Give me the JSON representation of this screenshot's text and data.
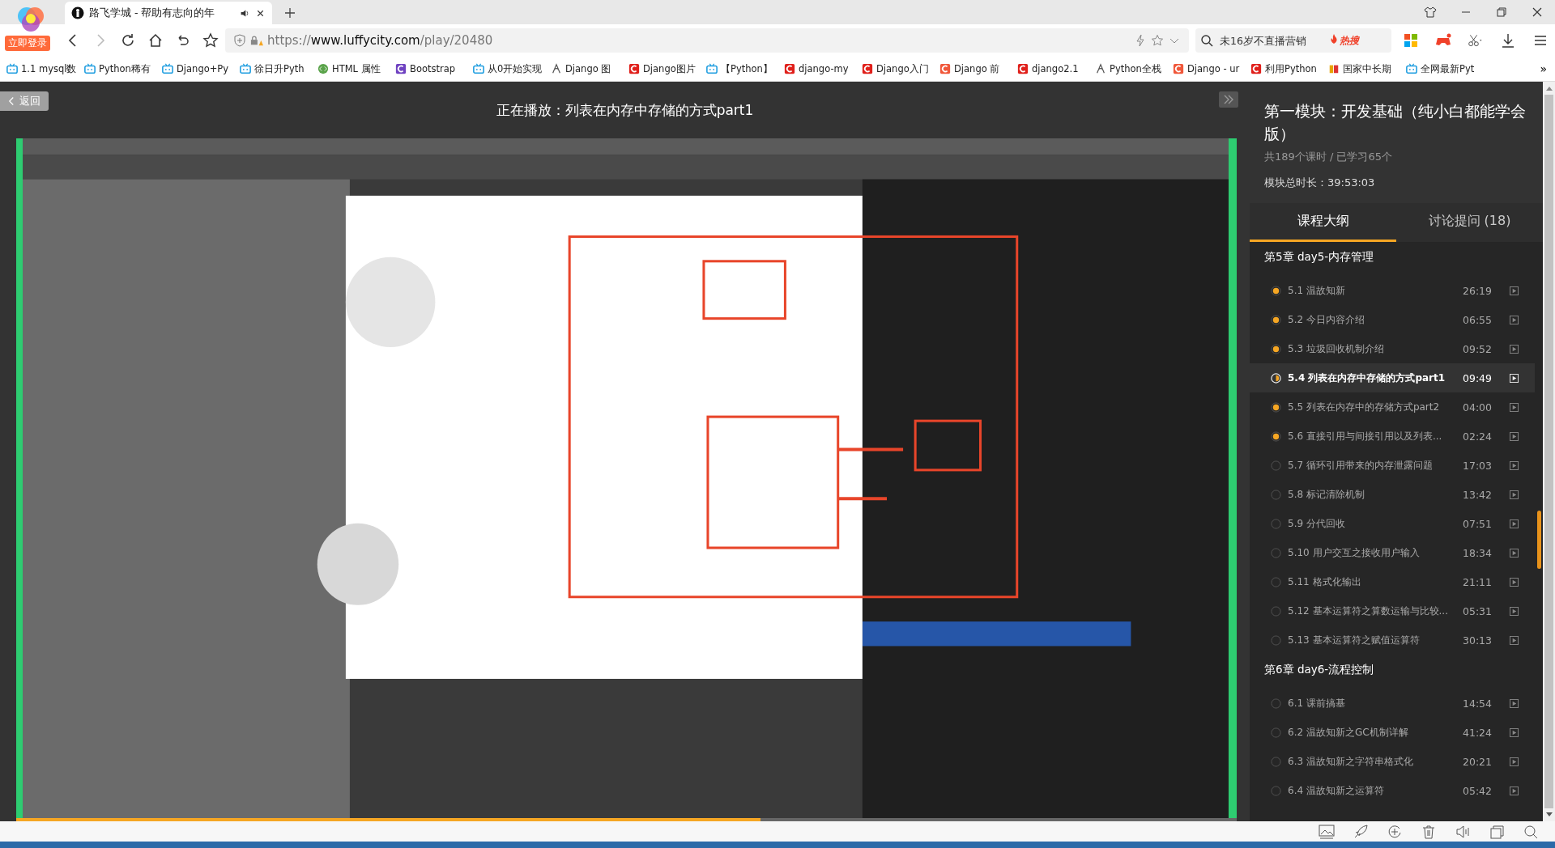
{
  "browser": {
    "login_badge": "立即登录",
    "tab": {
      "title": "路飞学城 - 帮助有志向的年",
      "audio": true
    },
    "url_prefix": "https://",
    "url_host": "www.luffycity.com",
    "url_path": "/play/20480",
    "search_placeholder": "未16岁不直播营销",
    "hot_badge": "热搜"
  },
  "bookmarks": [
    {
      "kind": "tv",
      "label": "1.1 mysql数"
    },
    {
      "kind": "tv",
      "label": "Python稀有"
    },
    {
      "kind": "tv",
      "label": "Django+Py"
    },
    {
      "kind": "tv",
      "label": "徐日升Pyth"
    },
    {
      "kind": "html",
      "label": "HTML 属性"
    },
    {
      "kind": "purple",
      "label": "Bootstrap"
    },
    {
      "kind": "tv",
      "label": "从0开始实现"
    },
    {
      "kind": "pen",
      "label": "Django 图"
    },
    {
      "kind": "red",
      "label": "Django图片"
    },
    {
      "kind": "tv",
      "label": "【Python】"
    },
    {
      "kind": "red",
      "label": "django-my"
    },
    {
      "kind": "red",
      "label": "Django入门"
    },
    {
      "kind": "orange",
      "label": "Django 前"
    },
    {
      "kind": "red",
      "label": "django2.1"
    },
    {
      "kind": "pen",
      "label": "Python全栈"
    },
    {
      "kind": "orange",
      "label": "Django - ur"
    },
    {
      "kind": "red",
      "label": "利用Python"
    },
    {
      "kind": "book",
      "label": "国家中长期"
    },
    {
      "kind": "tv",
      "label": "全网最新Pyt"
    }
  ],
  "bookmarks_more": "»",
  "player": {
    "back": "返回",
    "title": "正在播放：列表在内存中存储的方式part1",
    "progress": {
      "level": 0.61
    }
  },
  "sidebar": {
    "title": "第一模块：开发基础（纯小白都能学会版）",
    "lessons_summary": "共189个课时 / 已学习65个",
    "duration": "模块总时长：39:53:03",
    "tabs": [
      {
        "label": "课程大纲",
        "selected": true
      },
      {
        "label": "讨论提问 (18)",
        "selected": false
      }
    ],
    "chapters": [
      {
        "title": "第5章  day5-内存管理",
        "lessons": [
          {
            "title": "5.1 温故知新",
            "time": "26:19",
            "kind": "watched",
            "selected": false
          },
          {
            "title": "5.2 今日内容介绍",
            "time": "06:55",
            "kind": "watched",
            "selected": false
          },
          {
            "title": "5.3 垃圾回收机制介绍",
            "time": "09:52",
            "kind": "watched",
            "selected": false
          },
          {
            "title": "5.4 列表在内存中存储的方式part1",
            "time": "09:49",
            "kind": "playing",
            "selected": true
          },
          {
            "title": "5.5 列表在内存中的存储方式part2",
            "time": "04:00",
            "kind": "watched",
            "selected": false
          },
          {
            "title": "5.6 直接引用与间接引用以及列表...",
            "time": "02:24",
            "kind": "watched",
            "selected": false
          },
          {
            "title": "5.7 循环引用带来的内存泄露问题",
            "time": "17:03",
            "kind": "unwatched",
            "selected": false
          },
          {
            "title": "5.8 标记清除机制",
            "time": "13:42",
            "kind": "unwatched",
            "selected": false
          },
          {
            "title": "5.9 分代回收",
            "time": "07:51",
            "kind": "unwatched",
            "selected": false
          },
          {
            "title": "5.10 用户交互之接收用户输入",
            "time": "18:34",
            "kind": "unwatched",
            "selected": false
          },
          {
            "title": "5.11 格式化输出",
            "time": "21:11",
            "kind": "unwatched",
            "selected": false
          },
          {
            "title": "5.12 基本运算符之算数运输与比较...",
            "time": "05:31",
            "kind": "unwatched",
            "selected": false
          },
          {
            "title": "5.13 基本运算符之赋值运算符",
            "time": "30:13",
            "kind": "unwatched",
            "selected": false
          }
        ]
      },
      {
        "title": "第6章  day6-流程控制",
        "lessons": [
          {
            "title": "6.1 课前搞基",
            "time": "14:54",
            "kind": "unwatched",
            "selected": false
          },
          {
            "title": "6.2 温故知新之GC机制详解",
            "time": "41:24",
            "kind": "unwatched",
            "selected": false
          },
          {
            "title": "6.3 温故知新之字符串格式化",
            "time": "20:21",
            "kind": "unwatched",
            "selected": false
          },
          {
            "title": "6.4 温故知新之运算符",
            "time": "05:42",
            "kind": "unwatched",
            "selected": false
          }
        ]
      }
    ]
  }
}
